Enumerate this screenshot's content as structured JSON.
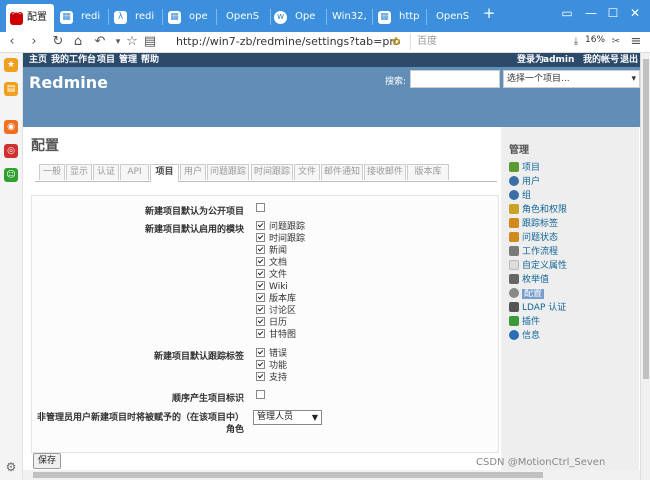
{
  "browser": {
    "tabs": [
      {
        "label": "配置",
        "icon": "redmine-icon"
      },
      {
        "label": "redi",
        "icon": "browser-tab-icon"
      },
      {
        "label": "redi",
        "icon": "browser-tab-icon"
      },
      {
        "label": "ope",
        "icon": "browser-tab-icon"
      },
      {
        "label": "OpenS",
        "icon": "browser-tab-icon"
      },
      {
        "label": "Ope",
        "icon": "browser-tab-icon"
      },
      {
        "label": "Win32,",
        "icon": "browser-tab-icon"
      },
      {
        "label": "http",
        "icon": "browser-tab-icon"
      },
      {
        "label": "OpenS",
        "icon": "browser-tab-icon"
      }
    ],
    "url": "http://win7-zb/redmine/settings?tab=pro",
    "search_placeholder": "百度",
    "zoom": "16%",
    "accent_color": "#3b8fdc"
  },
  "redmine": {
    "top_menu": {
      "left": [
        "主页",
        "我的工作台",
        "项目",
        "管理",
        "帮助"
      ],
      "logged_in_prefix": "登录为",
      "user": "admin",
      "my_account": "我的帐号",
      "logout": "退出"
    },
    "header": {
      "title": "Redmine",
      "search_label": "搜索:",
      "project_jump": "选择一个项目..."
    },
    "page_title": "配置",
    "tabs": [
      "一般",
      "显示",
      "认证",
      "API",
      "项目",
      "用户",
      "问题跟踪",
      "时间跟踪",
      "文件",
      "邮件通知",
      "接收邮件",
      "版本库"
    ],
    "selected_tab": "项目",
    "form": {
      "public_label": "新建项目默认为公开项目",
      "modules_label": "新建项目默认启用的模块",
      "modules": [
        "问题跟踪",
        "时间跟踪",
        "新闻",
        "文档",
        "文件",
        "Wiki",
        "版本库",
        "讨论区",
        "日历",
        "甘特图"
      ],
      "trackers_label": "新建项目默认跟踪标签",
      "trackers": [
        "错误",
        "功能",
        "支持"
      ],
      "sequential_label": "顺序产生项目标识",
      "role_label_line1": "非管理员用户新建项目时将被赋予的（在该项目中）",
      "role_label_line2": "角色",
      "role_value": "管理人员",
      "save_label": "保存"
    },
    "sidebar": {
      "title": "管理",
      "items": [
        {
          "label": "项目",
          "icon": "projects-icon",
          "color": "#5b9b2f"
        },
        {
          "label": "用户",
          "icon": "user-icon",
          "color": "#3a6ea5"
        },
        {
          "label": "组",
          "icon": "group-icon",
          "color": "#3a6ea5"
        },
        {
          "label": "角色和权限",
          "icon": "key-icon",
          "color": "#c9a227"
        },
        {
          "label": "跟踪标签",
          "icon": "ticket-icon",
          "color": "#d08a1e"
        },
        {
          "label": "问题状态",
          "icon": "status-icon",
          "color": "#d08a1e"
        },
        {
          "label": "工作流程",
          "icon": "workflow-icon",
          "color": "#7a7a7a"
        },
        {
          "label": "自定义属性",
          "icon": "custom-field-icon",
          "color": "#dddddd"
        },
        {
          "label": "枚举值",
          "icon": "list-icon",
          "color": "#666666"
        },
        {
          "label": "配置",
          "icon": "settings-icon",
          "color": "#888888"
        },
        {
          "label": "LDAP 认证",
          "icon": "server-icon",
          "color": "#555555"
        },
        {
          "label": "插件",
          "icon": "plugin-icon",
          "color": "#3a9a3a"
        },
        {
          "label": "信息",
          "icon": "info-icon",
          "color": "#2a6fb5"
        }
      ],
      "selected": "配置"
    }
  },
  "watermark": "CSDN @MotionCtrl_Seven"
}
